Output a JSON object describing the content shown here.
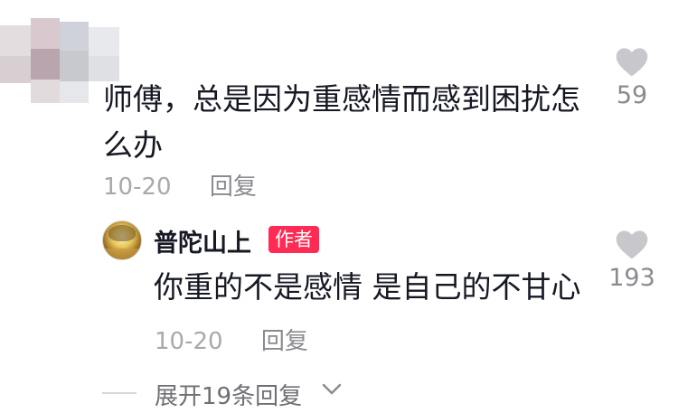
{
  "comment": {
    "text": "师傅，总是因为重感情而感到困扰怎么办",
    "date": "10-20",
    "reply_label": "回复",
    "likes": "59"
  },
  "reply": {
    "author": "普陀山上",
    "badge": "作者",
    "text": "你重的不是感情 是自己的不甘心",
    "date": "10-20",
    "reply_label": "回复",
    "likes": "193"
  },
  "expand": {
    "label": "展开19条回复"
  },
  "icons": {
    "like": "heart-icon",
    "expand": "chevron-down-icon"
  },
  "colors": {
    "badge": "#fe2c55",
    "like_icon": "#c8c8cc",
    "meta": "#a8a9ad"
  }
}
